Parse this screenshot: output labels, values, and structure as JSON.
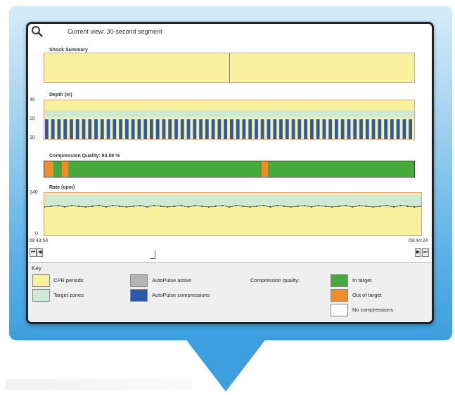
{
  "window": {
    "title": "Current view: 30-second segment"
  },
  "panels": {
    "shock": {
      "label": "Shock Summary"
    },
    "depth": {
      "label": "Depth (in)",
      "yticks": [
        "40",
        "20",
        "30"
      ]
    },
    "quality": {
      "label": "Compression Quality: 93.88 %"
    },
    "rate": {
      "label": "Rate (cpm)",
      "yticks": [
        "140",
        "0"
      ]
    }
  },
  "timeline": {
    "start": "09:43:54",
    "end": "09:44:24"
  },
  "nav": {
    "first": "⏮",
    "prev": "◀",
    "next": "▶",
    "last": "⏭"
  },
  "key": {
    "title": "Key",
    "cpr_periods": "CPR periods",
    "target_zones": "Target zones",
    "autopulse_active": "AutoPulse active",
    "autopulse_compressions": "AutoPulse compressions",
    "compression_quality": "Compression quality:",
    "in_target": "In target",
    "out_of_target": "Out of target",
    "no_compressions": "No compressions"
  },
  "colors": {
    "cpr_yellow": "#f9f1a0",
    "target_green": "#cfead0",
    "autopulse_gray": "#b5b5b5",
    "autopulse_blue": "#2c5aa8",
    "in_target": "#45a93b",
    "out_of_target": "#f08c2a",
    "no_compressions": "#ffffff"
  },
  "icons": {
    "search": "magnifier-icon"
  }
}
